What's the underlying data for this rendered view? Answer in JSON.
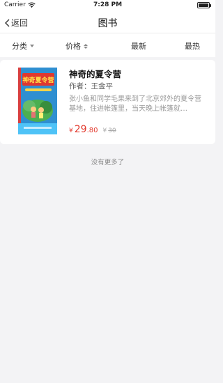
{
  "status_bar": {
    "carrier": "Carrier",
    "time": "7:28 PM"
  },
  "nav": {
    "back_label": "返回",
    "title": "图书"
  },
  "filters": {
    "category": "分类",
    "price": "价格",
    "newest": "最新",
    "hottest": "最热"
  },
  "book": {
    "title": "神奇的夏令营",
    "author": "作者：王金平",
    "description": "张小鱼和同学毛果来到了北京郊外的夏令营基地，住进帐篷里，当天晚上帐篷就…",
    "currency": "¥",
    "price_int": "29",
    "price_dec": ".80",
    "orig_currency": "¥",
    "orig_price": "30",
    "cover_text": "神奇夏令营"
  },
  "footer": {
    "no_more": "没有更多了"
  },
  "colors": {
    "price": "#e23a2e",
    "cover_bg": "#2f8fd1"
  }
}
